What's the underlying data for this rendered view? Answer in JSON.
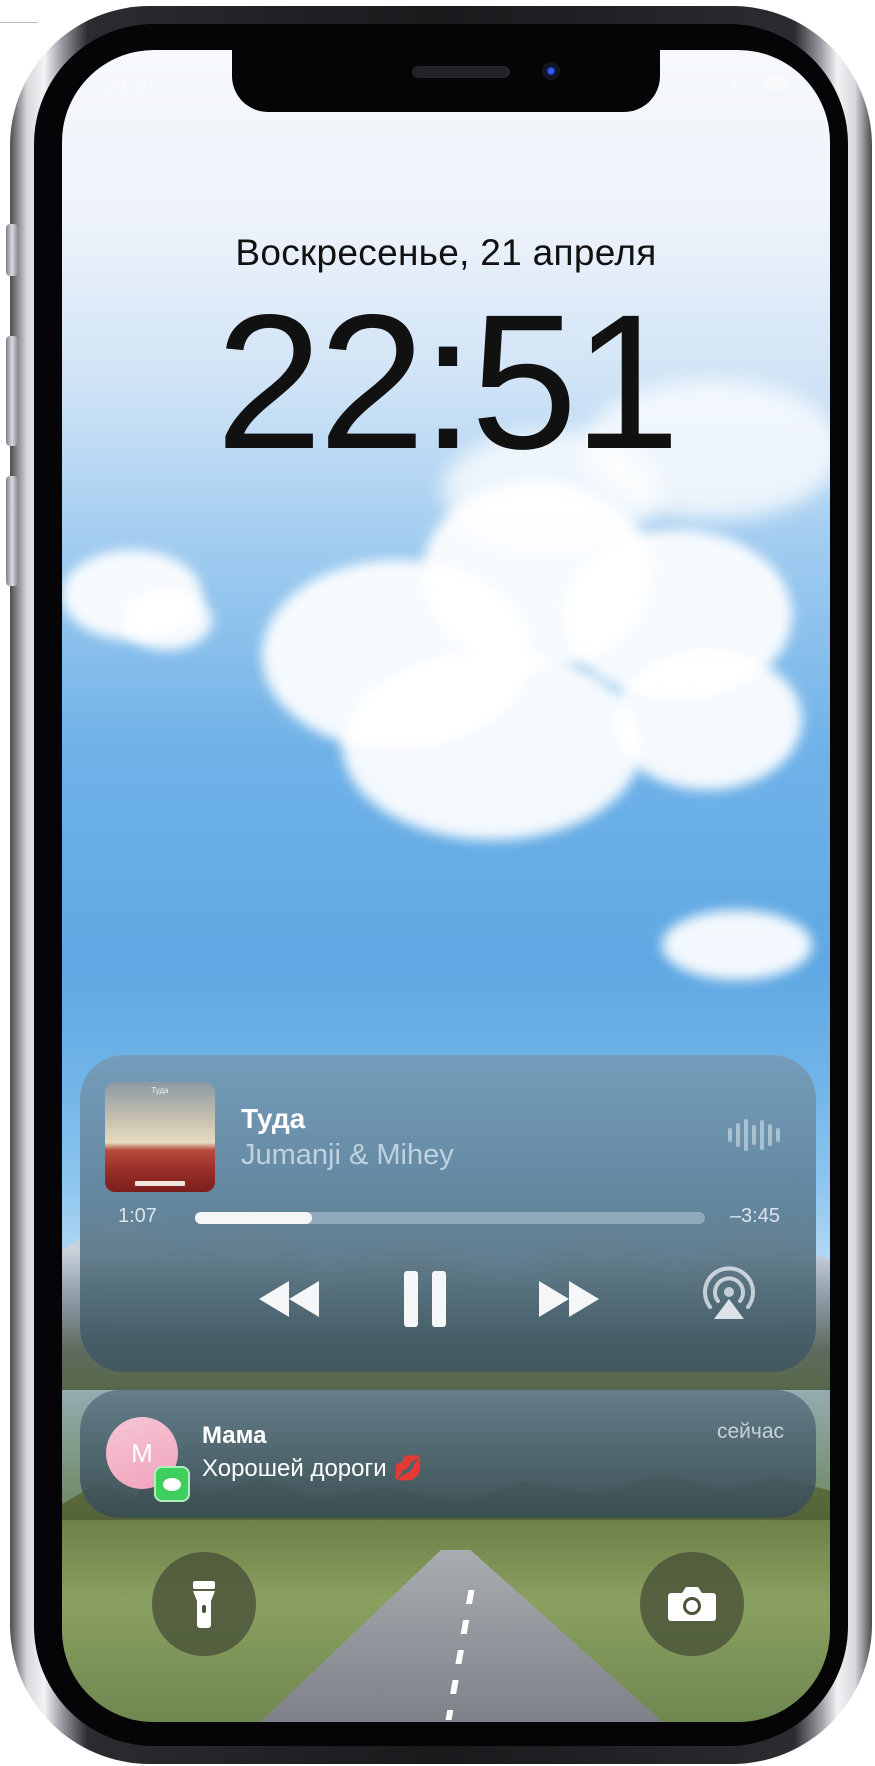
{
  "status_bar": {
    "time": "22:51"
  },
  "lock_screen": {
    "date": "Воскресенье, 21 апреля",
    "time": "22:51"
  },
  "now_playing": {
    "album_cover_title": "Туда",
    "title": "Туда",
    "artist": "Jumanji & Mihey",
    "elapsed": "1:07",
    "remaining": "–3:45",
    "progress": 0.23,
    "controls": [
      "rewind-icon",
      "pause-icon",
      "fast-forward-icon",
      "airplay-icon"
    ]
  },
  "notification": {
    "avatar_letter": "M",
    "sender": "Мама",
    "body": "Хорошей дороги 💋",
    "time": "сейчас",
    "app_icon": "messages-icon",
    "app_color": "#3ecf5e"
  },
  "quick_actions": [
    "flashlight-icon",
    "camera-icon"
  ]
}
